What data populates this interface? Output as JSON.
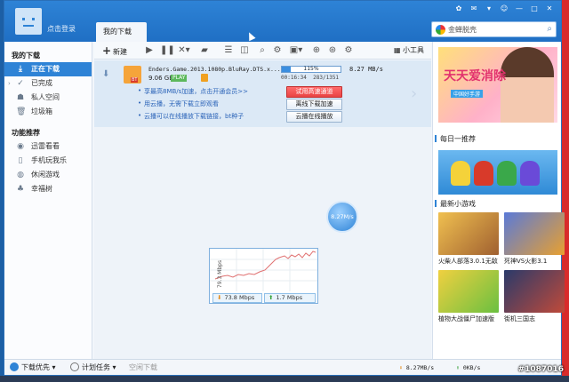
{
  "titlebar": {
    "login_label": "点击登录",
    "tab_label": "我的下载",
    "search_placeholder": "金蝉脱壳"
  },
  "nav": {
    "section_downloads": "我的下载",
    "items": [
      {
        "label": "正在下载",
        "icon": "download-icon"
      },
      {
        "label": "已完成",
        "icon": "check-icon"
      },
      {
        "label": "私人空间",
        "icon": "user-icon"
      },
      {
        "label": "垃圾箱",
        "icon": "trash-icon"
      }
    ],
    "section_recommend": "功能推荐",
    "rec_items": [
      {
        "label": "迅雷看看",
        "icon": "film-icon"
      },
      {
        "label": "手机玩我乐",
        "icon": "phone-icon"
      },
      {
        "label": "休闲游戏",
        "icon": "gamepad-icon"
      },
      {
        "label": "幸福树",
        "icon": "tree-icon"
      }
    ]
  },
  "toolbar": {
    "new_label": "新建",
    "tools_label": "小工具"
  },
  "task": {
    "filename": "Enders.Game.2013.1080p.BluRay.DTS.x...",
    "size": "9.06 GB",
    "play_badge": "PLAY",
    "progress_text": "115%",
    "progress": 0.15,
    "elapsed": "00:16:34",
    "pieces": "283/1351",
    "speed": "8.27 MB/s",
    "tips": [
      "享最高8MB/s加速，点击开通会员>>",
      "用云播，无需下载立即观看",
      "云播可以在线播放下载链接，bt种子"
    ],
    "btn_trial": "试用高速通道",
    "btn_offline": "离线下载加速",
    "btn_cloud": "云播在线播放"
  },
  "bubble_speed": "8.27M/s",
  "graph": {
    "ylabel": "79.3 Mbps",
    "down": "73.8 Mbps",
    "up": "1.7 Mbps"
  },
  "side": {
    "ad_brand": "天天爱消除",
    "ad_sub": "中国好手游",
    "daily_title": "每日一推荐",
    "games_title": "最新小游戏",
    "games": [
      {
        "caption": "火柴人部落3.0.1无敌"
      },
      {
        "caption": "死神VS火影3.1"
      },
      {
        "caption": "植物大战僵尸加速版"
      },
      {
        "caption": "街机三国志"
      }
    ]
  },
  "status": {
    "priority_label": "下载优先",
    "schedule_label": "计划任务",
    "idle_label": "空闲下载",
    "down_speed": "8.27MB/s",
    "up_speed": "0KB/s"
  },
  "watermark": "#1087016"
}
